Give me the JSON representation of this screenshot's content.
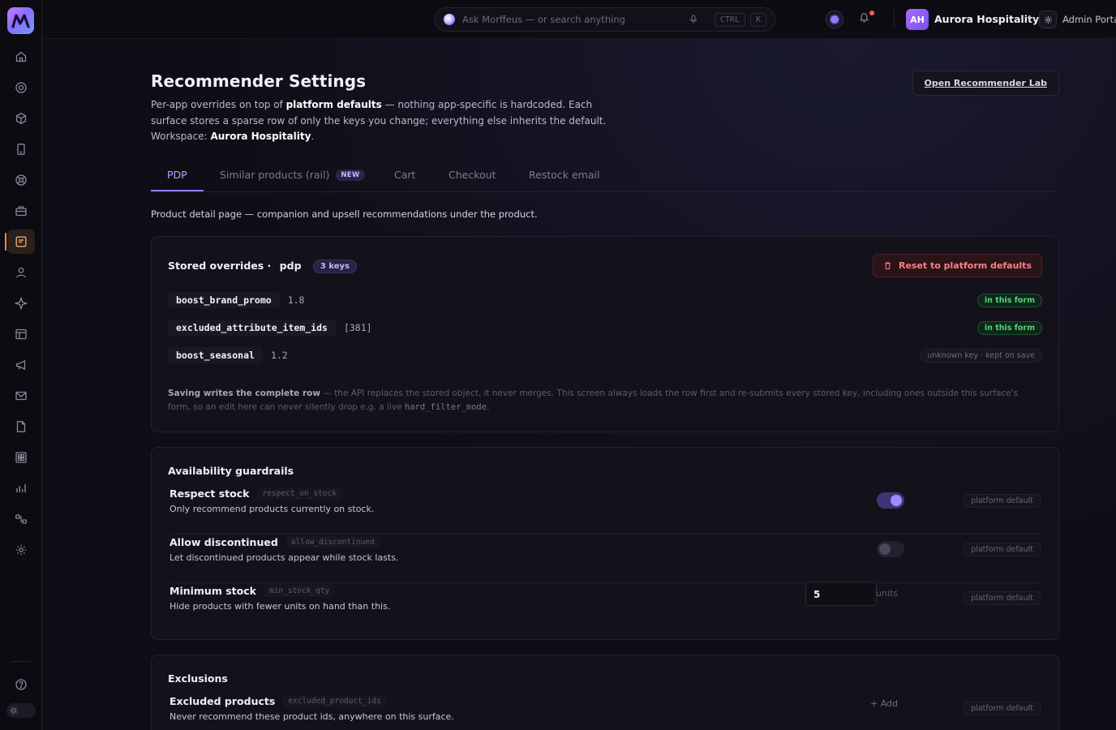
{
  "topbar": {
    "search_placeholder": "Ask Morffeus — or search anything",
    "kbd_ctrl": "CTRL",
    "kbd_k": "K",
    "avatar_initials": "AH",
    "workspace_name": "Aurora Hospitality",
    "portal_label": "Admin Portal"
  },
  "sidebar": {
    "items": [
      "home-icon",
      "target-icon",
      "box-icon",
      "device-icon",
      "globe-icon",
      "briefcase-icon",
      "recommender-icon",
      "user-icon",
      "sparkle-icon",
      "table-icon",
      "megaphone-icon",
      "mail-icon",
      "document-icon",
      "grid-icon",
      "bar-chart-icon",
      "flow-icon",
      "settings-icon"
    ],
    "active_item": "recommender-icon",
    "accent": "#ff8a3d"
  },
  "page": {
    "title": "Recommender Settings",
    "desc_part1": "Per-app overrides on top of ",
    "desc_bold1": "platform defaults",
    "desc_part2": " — nothing app-specific is hardcoded. Each surface stores a sparse row of only the keys you change; everything else inherits the default. Workspace: ",
    "desc_bold2": "Aurora Hospitality",
    "desc_part3": ".",
    "lab_button": "Open Recommender Lab"
  },
  "tabs": [
    {
      "label": "PDP",
      "active": true
    },
    {
      "label": "Similar products (rail)",
      "badge": "NEW"
    },
    {
      "label": "Cart"
    },
    {
      "label": "Checkout"
    },
    {
      "label": "Restock email"
    }
  ],
  "surface_desc": "Product detail page — companion and upsell recommendations under the product.",
  "overrides": {
    "title": "Stored overrides ·",
    "surface": "pdp",
    "count_badge": "3 keys",
    "reset_button": "Reset to platform defaults",
    "rows": [
      {
        "key": "boost_brand_promo",
        "value": "1.8",
        "status": "in this form"
      },
      {
        "key": "excluded_attribute_item_ids",
        "value": "[381]",
        "status": "in this form"
      },
      {
        "key": "boost_seasonal",
        "value": "1.2",
        "status": "unknown key · kept on save"
      }
    ],
    "note_bold": "Saving writes the complete row",
    "note_text": " — the API replaces the stored object, it never merges. This screen always loads the row first and re-submits every stored key, including ones outside this surface's form, so an edit here can never silently drop e.g. a live ",
    "note_code": "hard_filter_mode",
    "note_end": "."
  },
  "availability": {
    "title": "Availability guardrails",
    "rows": [
      {
        "label": "Respect stock",
        "key": "respect_on_stock",
        "desc": "Only recommend products currently on stock.",
        "control": "toggle",
        "on": true,
        "badge": "platform default"
      },
      {
        "label": "Allow discontinued",
        "key": "allow_discontinued",
        "desc": "Let discontinued products appear while stock lasts.",
        "control": "toggle",
        "on": false,
        "badge": "platform default"
      },
      {
        "label": "Minimum stock",
        "key": "min_stock_qty",
        "desc": "Hide products with fewer units on hand than this.",
        "control": "number",
        "value": "5",
        "unit": "units",
        "badge": "platform default"
      }
    ]
  },
  "exclusions": {
    "title": "Exclusions",
    "rows": [
      {
        "label": "Excluded products",
        "key": "excluded_product_ids",
        "desc": "Never recommend these product ids, anywhere on this surface.",
        "action": "+ Add",
        "badge": "platform default"
      }
    ]
  }
}
